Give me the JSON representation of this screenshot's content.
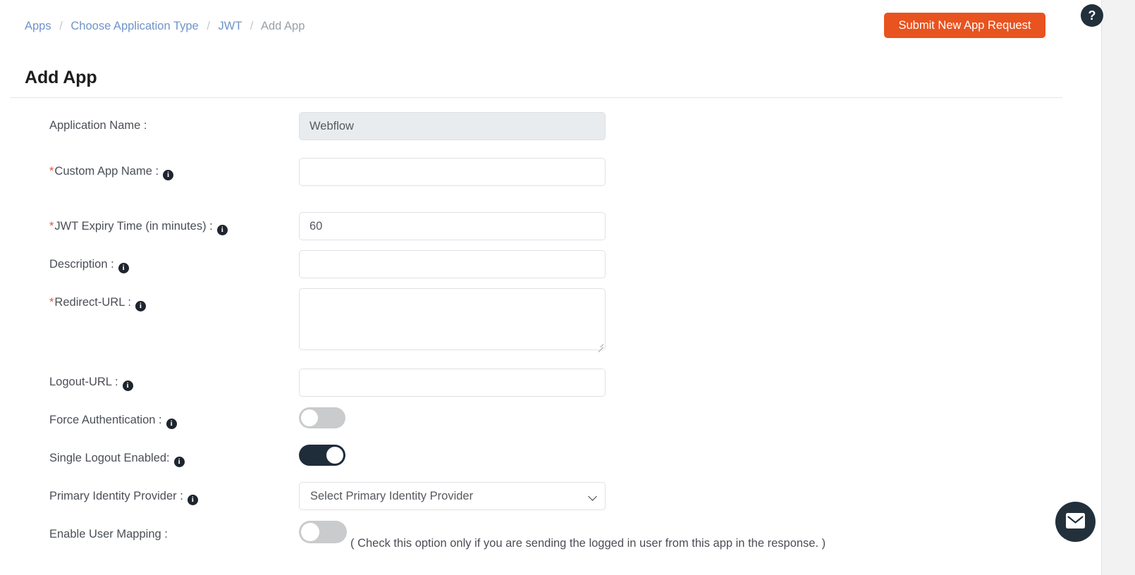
{
  "breadcrumb": {
    "items": [
      {
        "label": "Apps",
        "current": false
      },
      {
        "label": "Choose Application Type",
        "current": false
      },
      {
        "label": "JWT",
        "current": false
      },
      {
        "label": "Add App",
        "current": true
      }
    ],
    "separator": "/"
  },
  "header": {
    "title": "Add App",
    "submit_label": "Submit New App Request"
  },
  "colors": {
    "accent_orange": "#e8531f",
    "toggle_on": "#1f2d3a",
    "toggle_off": "#c9cbcd",
    "required_star": "#e8533f",
    "link": "#6f93c9"
  },
  "form": {
    "fields": [
      {
        "key": "application_name",
        "label": "Application Name :",
        "required": false,
        "has_info_icon": false,
        "control": "text",
        "value": "Webflow",
        "placeholder": "",
        "disabled": true
      },
      {
        "key": "custom_app_name",
        "label": "Custom App Name :",
        "required": true,
        "has_info_icon": true,
        "control": "text",
        "value": "",
        "placeholder": "",
        "disabled": false
      },
      {
        "key": "jwt_expiry_time",
        "label": "JWT Expiry Time (in minutes) :",
        "required": true,
        "has_info_icon": true,
        "control": "text",
        "value": "60",
        "placeholder": "",
        "disabled": false
      },
      {
        "key": "description",
        "label": "Description :",
        "required": false,
        "has_info_icon": true,
        "control": "text",
        "value": "",
        "placeholder": "",
        "disabled": false
      },
      {
        "key": "redirect_url",
        "label": "Redirect-URL :",
        "required": true,
        "has_info_icon": true,
        "control": "textarea",
        "value": "",
        "placeholder": "",
        "disabled": false
      },
      {
        "key": "logout_url",
        "label": "Logout-URL :",
        "required": false,
        "has_info_icon": true,
        "control": "text",
        "value": "",
        "placeholder": "",
        "disabled": false
      },
      {
        "key": "force_authentication",
        "label": "Force Authentication :",
        "required": false,
        "has_info_icon": true,
        "control": "toggle",
        "checked": false
      },
      {
        "key": "single_logout_enabled",
        "label": "Single Logout Enabled:",
        "required": false,
        "has_info_icon": true,
        "control": "toggle",
        "checked": true
      },
      {
        "key": "primary_identity_provider",
        "label": "Primary Identity Provider :",
        "required": false,
        "has_info_icon": true,
        "control": "select",
        "value": "Select Primary Identity Provider"
      },
      {
        "key": "enable_user_mapping",
        "label": "Enable User Mapping :",
        "required": false,
        "has_info_icon": false,
        "control": "toggle",
        "checked": false,
        "helper_text": "( Check this option only if you are sending the logged in user from this app in the response. )"
      }
    ],
    "info_icon_glyph": "i"
  },
  "widgets": {
    "help_label": "?",
    "chat_icon": "envelope-icon"
  }
}
